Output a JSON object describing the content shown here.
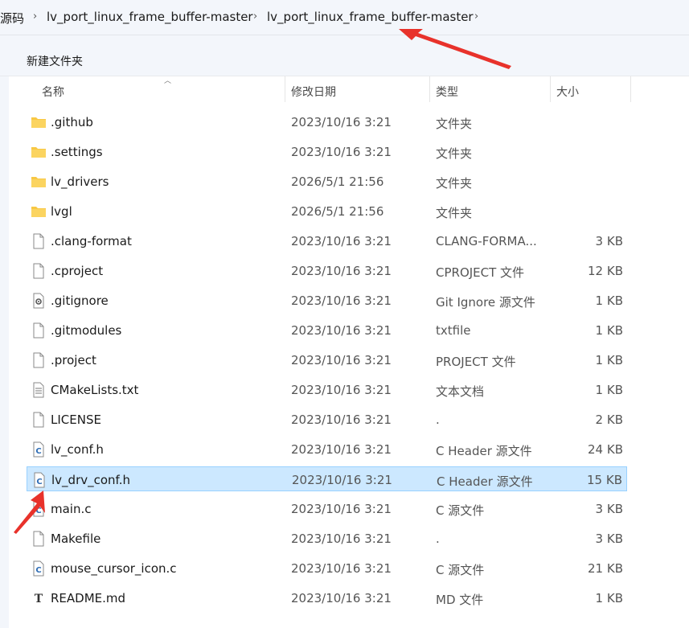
{
  "breadcrumb": {
    "items": [
      "源码",
      "lv_port_linux_frame_buffer-master",
      "lv_port_linux_frame_buffer-master"
    ],
    "separator": "›"
  },
  "toolbar": {
    "new_folder_label": "新建文件夹"
  },
  "columns": {
    "name": "名称",
    "modified": "修改日期",
    "type": "类型",
    "size": "大小"
  },
  "files": [
    {
      "name": ".github",
      "modified": "2023/10/16 3:21",
      "type": "文件夹",
      "size": "",
      "icon": "folder-icon"
    },
    {
      "name": ".settings",
      "modified": "2023/10/16 3:21",
      "type": "文件夹",
      "size": "",
      "icon": "folder-icon"
    },
    {
      "name": "lv_drivers",
      "modified": "2026/5/1 21:56",
      "type": "文件夹",
      "size": "",
      "icon": "folder-icon"
    },
    {
      "name": "lvgl",
      "modified": "2026/5/1 21:56",
      "type": "文件夹",
      "size": "",
      "icon": "folder-icon"
    },
    {
      "name": ".clang-format",
      "modified": "2023/10/16 3:21",
      "type": "CLANG-FORMA...",
      "size": "3 KB",
      "icon": "file-icon"
    },
    {
      "name": ".cproject",
      "modified": "2023/10/16 3:21",
      "type": "CPROJECT 文件",
      "size": "12 KB",
      "icon": "file-icon"
    },
    {
      "name": ".gitignore",
      "modified": "2023/10/16 3:21",
      "type": "Git Ignore 源文件",
      "size": "1 KB",
      "icon": "settings-file-icon"
    },
    {
      "name": ".gitmodules",
      "modified": "2023/10/16 3:21",
      "type": "txtfile",
      "size": "1 KB",
      "icon": "file-icon"
    },
    {
      "name": ".project",
      "modified": "2023/10/16 3:21",
      "type": "PROJECT 文件",
      "size": "1 KB",
      "icon": "file-icon"
    },
    {
      "name": "CMakeLists.txt",
      "modified": "2023/10/16 3:21",
      "type": "文本文档",
      "size": "1 KB",
      "icon": "text-file-icon"
    },
    {
      "name": "LICENSE",
      "modified": "2023/10/16 3:21",
      "type": ".",
      "size": "2 KB",
      "icon": "file-icon"
    },
    {
      "name": "lv_conf.h",
      "modified": "2023/10/16 3:21",
      "type": "C Header 源文件",
      "size": "24 KB",
      "icon": "c-file-icon"
    },
    {
      "name": "lv_drv_conf.h",
      "modified": "2023/10/16 3:21",
      "type": "C Header 源文件",
      "size": "15 KB",
      "icon": "c-file-icon",
      "selected": true
    },
    {
      "name": "main.c",
      "modified": "2023/10/16 3:21",
      "type": "C 源文件",
      "size": "3 KB",
      "icon": "c-file-icon"
    },
    {
      "name": "Makefile",
      "modified": "2023/10/16 3:21",
      "type": ".",
      "size": "3 KB",
      "icon": "file-icon"
    },
    {
      "name": "mouse_cursor_icon.c",
      "modified": "2023/10/16 3:21",
      "type": "C 源文件",
      "size": "21 KB",
      "icon": "c-file-icon"
    },
    {
      "name": "README.md",
      "modified": "2023/10/16 3:21",
      "type": "MD 文件",
      "size": "1 KB",
      "icon": "markdown-file-icon"
    }
  ],
  "colors": {
    "selection_bg": "#cce8ff",
    "selection_border": "#99d1ff",
    "folder": "#f8c844",
    "annotation_arrow": "#e8322b"
  }
}
